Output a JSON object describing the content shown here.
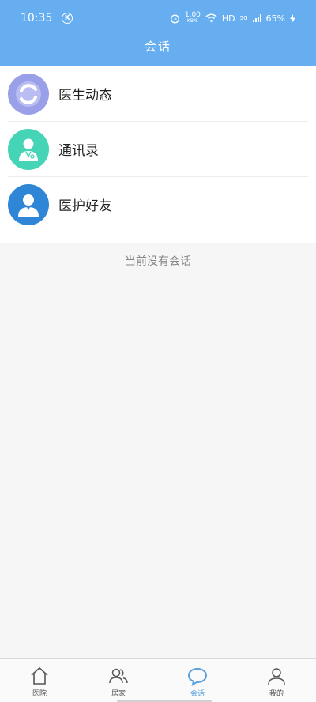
{
  "status_bar": {
    "time": "10:35",
    "badge": "K",
    "speed_value": "1.00",
    "speed_unit": "KB/S",
    "hd": "HD",
    "network": "5G",
    "battery": "65%"
  },
  "header": {
    "title": "会话"
  },
  "list": {
    "items": [
      {
        "label": "医生动态",
        "icon": "refresh-ring-icon",
        "color": "#9aa0e8"
      },
      {
        "label": "通讯录",
        "icon": "doctor-icon",
        "color": "#46d4b6"
      },
      {
        "label": "医护好友",
        "icon": "person-icon",
        "color": "#2f86d6"
      }
    ]
  },
  "empty_message": "当前没有会话",
  "tabbar": {
    "tabs": [
      {
        "label": "医院",
        "icon": "home-icon"
      },
      {
        "label": "居家",
        "icon": "users-icon"
      },
      {
        "label": "会话",
        "icon": "chat-bubble-icon",
        "active": true
      },
      {
        "label": "我的",
        "icon": "profile-icon"
      }
    ]
  },
  "colors": {
    "header": "#66aef0",
    "accent": "#5b9fdc"
  }
}
